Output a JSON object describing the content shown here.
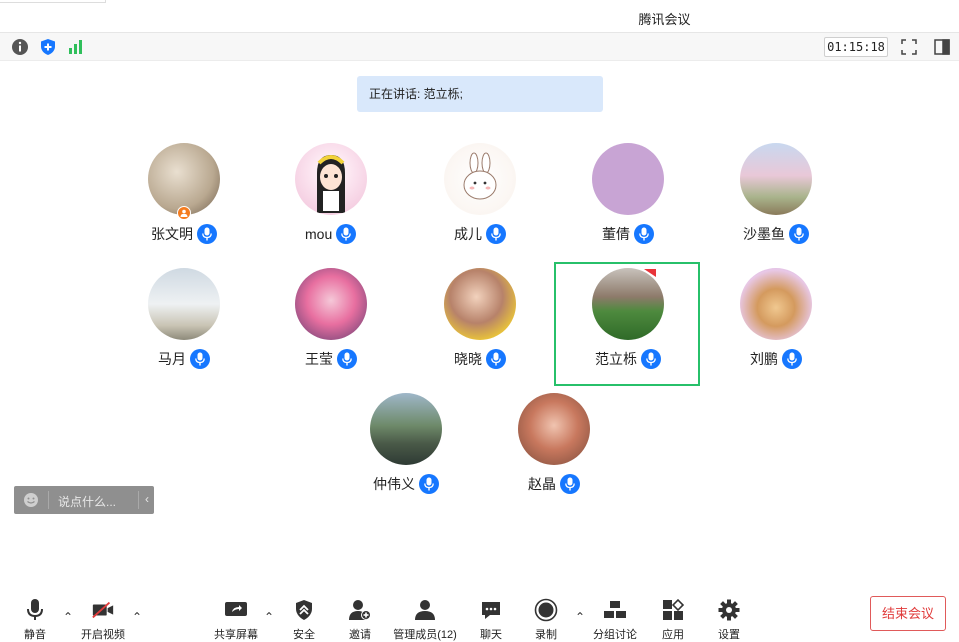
{
  "window": {
    "title": "腾讯会议"
  },
  "infobar": {
    "timer": "01:15:18"
  },
  "speaking": {
    "text": "正在讲话: 范立栎;"
  },
  "participants": [
    {
      "name": "张文明"
    },
    {
      "name": "mou"
    },
    {
      "name": "成儿"
    },
    {
      "name": "董倩"
    },
    {
      "name": "沙墨鱼"
    },
    {
      "name": "马月"
    },
    {
      "name": "王莹"
    },
    {
      "name": "晓晓"
    },
    {
      "name": "范立栎"
    },
    {
      "name": "刘鹏"
    },
    {
      "name": "仲伟义"
    },
    {
      "name": "赵晶"
    }
  ],
  "chat": {
    "placeholder": "说点什么..."
  },
  "toolbar": {
    "mute": "静音",
    "video": "开启视频",
    "share": "共享屏幕",
    "security": "安全",
    "invite": "邀请",
    "members": "管理成员(12)",
    "chat": "聊天",
    "record": "录制",
    "breakout": "分组讨论",
    "apps": "应用",
    "settings": "设置",
    "end": "结束会议"
  },
  "colors": {
    "accent": "#1677ff",
    "active_border": "#27c06a",
    "end": "#e03a3a",
    "speaking_bg": "#d9e8fb"
  }
}
